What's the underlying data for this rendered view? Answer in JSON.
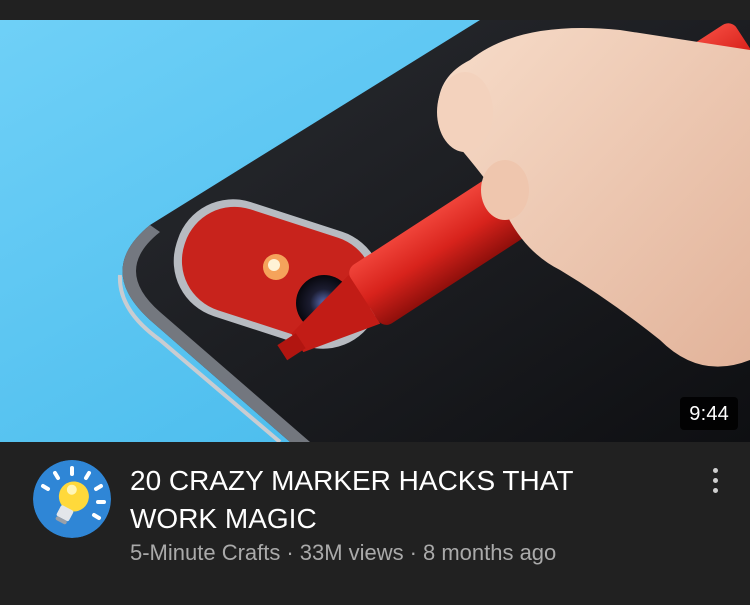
{
  "video": {
    "duration": "9:44",
    "title": "20 CRAZY MARKER HACKS THAT WORK MAGIC",
    "channel": "5-Minute Crafts",
    "views": "33M views",
    "age": "8 months ago",
    "separator": "·"
  },
  "icons": {
    "avatar": "lightbulb-icon",
    "more": "more-vert-icon"
  },
  "colors": {
    "background": "#212121",
    "thumbnail_sky": "#5cc6f2",
    "marker_red": "#d8231c",
    "meta_text": "#aaaaaa"
  }
}
